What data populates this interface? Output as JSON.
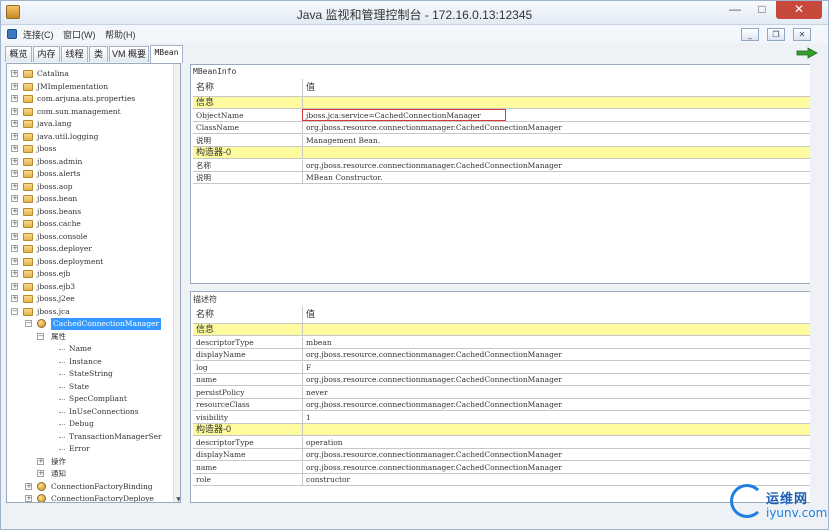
{
  "window": {
    "title": "Java 监视和管理控制台 - 172.16.0.13:12345"
  },
  "menubar": {
    "items": [
      "连接(C)",
      "窗口(W)",
      "帮助(H)"
    ],
    "mdi_buttons": [
      "_",
      "❐",
      "✕"
    ]
  },
  "tabs": [
    "概览",
    "内存",
    "线程",
    "类",
    "VM 概要",
    "MBean"
  ],
  "tree": {
    "domains": [
      "Catalina",
      "JMImplementation",
      "com.arjuna.ats.properties",
      "com.sun.management",
      "java.lang",
      "java.util.logging",
      "jboss",
      "jboss.admin",
      "jboss.alerts",
      "jboss.aop",
      "jboss.bean",
      "jboss.beans",
      "jboss.cache",
      "jboss.console",
      "jboss.deployer",
      "jboss.deployment",
      "jboss.ejb",
      "jboss.ejb3",
      "jboss.j2ee",
      "jboss.jca"
    ],
    "selected_node": "CachedConnectionManager",
    "attributes_label": "属性",
    "attributes": [
      "Name",
      "Instance",
      "StateString",
      "State",
      "SpecCompliant",
      "InUseConnections",
      "Debug",
      "TransactionManagerSer",
      "Error"
    ],
    "operations_label": "操作",
    "notifications_label": "通知",
    "siblings": [
      "ConnectionFactoryBinding",
      "ConnectionFactoryDeploye"
    ]
  },
  "mbean_info": {
    "label": "MBeanInfo",
    "col_name": "名称",
    "col_value": "值",
    "rows": [
      {
        "name": "信息",
        "value": "",
        "section": true
      },
      {
        "name": "ObjectName",
        "value": "jboss.jca:service=CachedConnectionManager",
        "section": false
      },
      {
        "name": "ClassName",
        "value": "org.jboss.resource.connectionmanager.CachedConnectionManager",
        "section": false
      },
      {
        "name": "说明",
        "value": "Management Bean.",
        "section": false
      },
      {
        "name": "构造器-0",
        "value": "",
        "section": true
      },
      {
        "name": "名称",
        "value": "org.jboss.resource.connectionmanager.CachedConnectionManager",
        "section": false
      },
      {
        "name": "说明",
        "value": "MBean Constructor.",
        "section": false
      }
    ]
  },
  "descriptor": {
    "label": "描述符",
    "col_name": "名称",
    "col_value": "值",
    "rows": [
      {
        "name": "信息",
        "value": "",
        "section": true
      },
      {
        "name": "descriptorType",
        "value": "mbean",
        "section": false
      },
      {
        "name": "displayName",
        "value": "org.jboss.resource.connectionmanager.CachedConnectionManager",
        "section": false
      },
      {
        "name": "log",
        "value": "F",
        "section": false
      },
      {
        "name": "name",
        "value": "org.jboss.resource.connectionmanager.CachedConnectionManager",
        "section": false
      },
      {
        "name": "persistPolicy",
        "value": "never",
        "section": false
      },
      {
        "name": "resourceClass",
        "value": "org.jboss.resource.connectionmanager.CachedConnectionManager",
        "section": false
      },
      {
        "name": "visibility",
        "value": "1",
        "section": false
      },
      {
        "name": "构造器-0",
        "value": "",
        "section": true
      },
      {
        "name": "descriptorType",
        "value": "operation",
        "section": false
      },
      {
        "name": "displayName",
        "value": "org.jboss.resource.connectionmanager.CachedConnectionManager",
        "section": false
      },
      {
        "name": "name",
        "value": "org.jboss.resource.connectionmanager.CachedConnectionManager",
        "section": false
      },
      {
        "name": "role",
        "value": "constructor",
        "section": false
      }
    ]
  },
  "watermark": {
    "text": "运维网",
    "sub": "iyunv.com"
  },
  "colors": {
    "section_bg": "#fdfb9e",
    "selection": "#3399ff",
    "highlight_box": "#d53a3a",
    "close_button": "#c7493b"
  }
}
